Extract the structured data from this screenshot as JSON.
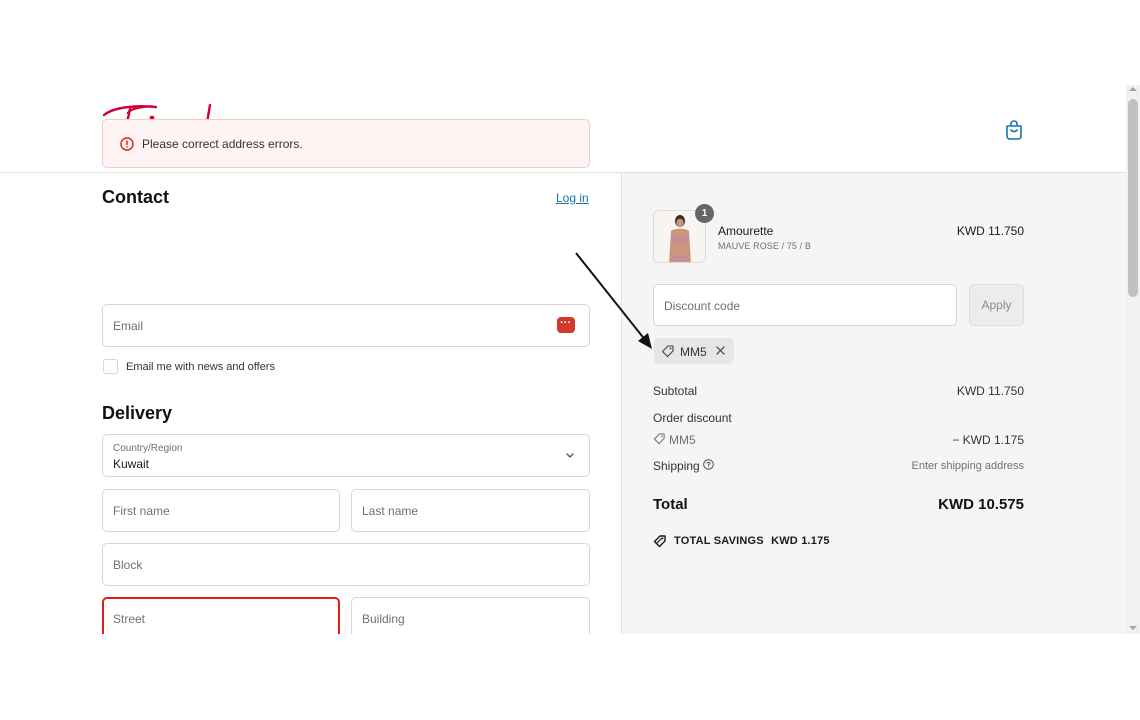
{
  "header": {
    "brand": "Triumph",
    "cart_icon": "shopping-bag-icon"
  },
  "error_banner": {
    "icon": "alert-circle-icon",
    "message": "Please correct address errors."
  },
  "contact": {
    "title": "Contact",
    "login_link": "Log in",
    "email_placeholder": "Email",
    "newsletter_label": "Email me with news and offers"
  },
  "delivery": {
    "title": "Delivery",
    "country_label": "Country/Region",
    "country_value": "Kuwait",
    "first_name_placeholder": "First name",
    "last_name_placeholder": "Last name",
    "block_placeholder": "Block",
    "street_placeholder": "Street",
    "building_placeholder": "Building"
  },
  "summary": {
    "product": {
      "name": "Amourette",
      "variant": "MAUVE ROSE / 75 / B",
      "price": "KWD 11.750",
      "quantity": "1"
    },
    "discount_placeholder": "Discount code",
    "apply_label": "Apply",
    "applied_code": "MM5",
    "subtotal_label": "Subtotal",
    "subtotal_value": "KWD 11.750",
    "order_discount_label": "Order discount",
    "order_discount_code": "MM5",
    "order_discount_value": "− KWD 1.175",
    "shipping_label": "Shipping",
    "shipping_value": "Enter shipping address",
    "total_label": "Total",
    "total_value": "KWD 10.575",
    "savings_label": "TOTAL SAVINGS",
    "savings_value": "KWD 1.175"
  },
  "colors": {
    "brand": "#d4003c",
    "error": "#dd1d1d",
    "link": "#1773b0"
  }
}
